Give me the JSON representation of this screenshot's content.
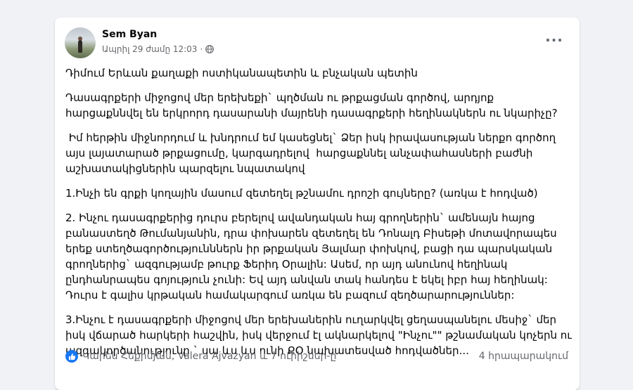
{
  "post": {
    "author": "Sem Byan",
    "timestamp": "Ապրիլ 29 ժամը 12:03",
    "separator": "·",
    "privacy_icon": "globe-icon",
    "more_icon": "more-options-icon",
    "paragraphs": [
      "Դիմում Երևան քաղաքի ոստիկանապետին և բնչական պետին",
      "Դասագրքերի միջոցով մեր երեխեքի` պղծման ու թրքացման գործով, արդյոք հարցաքննվել են երկրորդ դասարանի մայրենի դասագրքերի հեղինակներն ու նկարիչը?",
      " Իմ հերթին միջնորդում և խնդրում եմ կասեցնել` Ձեր իսկ իրավասության ներքո գործող այս լայատարած թրքացումը, կարգադրելով  հարցաքննել անչափահասների բաժնի աշխատակիցներին պարզելու նպատակով",
      "1.Ինչի են գրքի կողային մասում զետեղել թշնամու դրոշի գույները? (առկա է հոդված)",
      "2. Ինչու դասագրքերից դուրս բերելով ավանդական հայ գրողներին` ամենայն հայոց բանաստեղծ Թումանյանին, դրա փոխարեն զետեղել են Դոնալդ Բիսեթի մոտավորապես երեք ստեղծագործությունններն իր թրքական Յալմար փոխկով, բացի դա պարսկական գրողներից` ազգությամբ թուրք Ֆերիդ Օրալին: Ասեմ, որ այդ անունով հեղինակ ընդհանրապես գոյություն չունի: Եվ այդ անվան տակ հանդես է եկել իբր հայ հեղինակ: Դուրս է գալիս կրթական համակարգում առկա են բազում զեղծարարություններ:",
      "3.Ինչու է դասագրքերի միջոցով մեր երեխաներին ուղարկվել ցեղասպանելու մեսիջ` մեր իսկ վճարած հարկերի հաշվին, իսկ վերջում էլ ակնարկելով \"Ինչու\"\" թշնամական կոչերն ու ազգակործանությունը ` սա ևս ևս ունի ՔՕ նախատեսված հոդվածներ..."
    ],
    "reactions_text": "Կարեն Հեքիմյան, Valera Ajvazyan և 7 ուրիշներ-ը",
    "reaction_icon": "like-icon",
    "shares_text": "4 հրապարակում"
  },
  "colors": {
    "page_bg": "#f0f2f5",
    "card_bg": "#ffffff",
    "secondary_text": "#65676b",
    "like_blue": "#1877f2"
  }
}
